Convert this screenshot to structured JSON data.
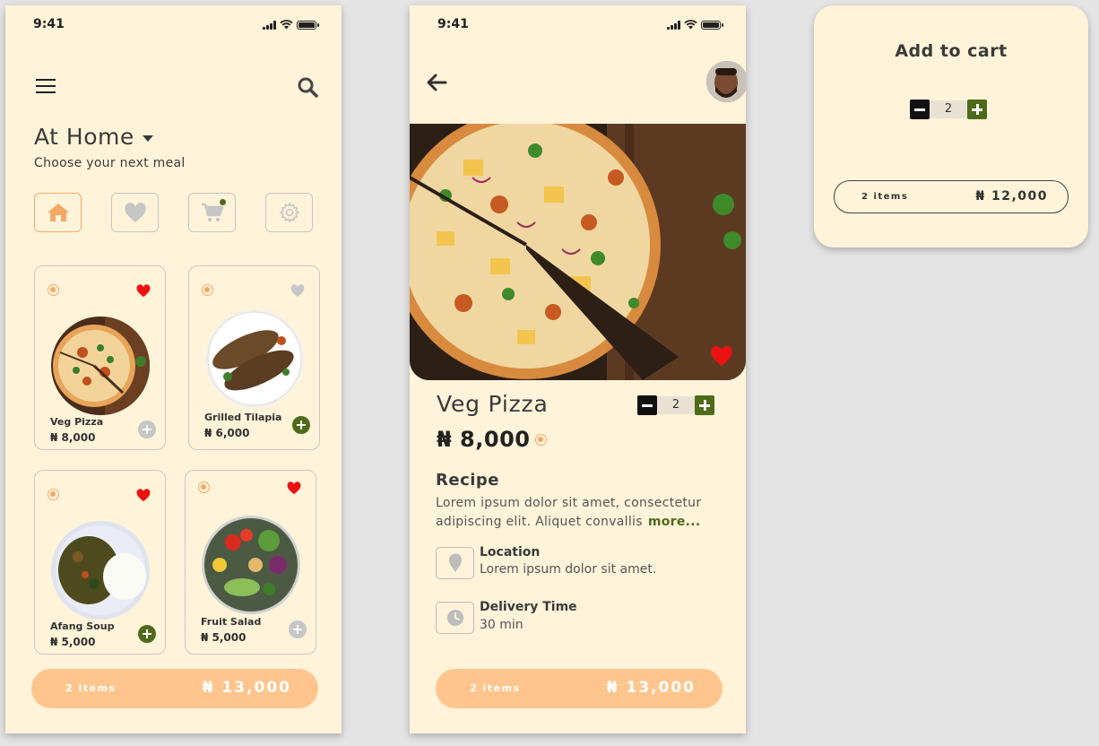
{
  "status_bar": {
    "time": "9:41"
  },
  "home": {
    "location_title": "At Home",
    "subtitle": "Choose your next meal",
    "nav": [
      {
        "name": "home",
        "active": true
      },
      {
        "name": "favorites",
        "active": false
      },
      {
        "name": "cart",
        "active": false,
        "badge": true
      },
      {
        "name": "settings",
        "active": false
      }
    ],
    "meals": [
      {
        "name": "Veg Pizza",
        "price": "₦ 8,000",
        "favorite": true,
        "added": false
      },
      {
        "name": "Grilled Tilapia",
        "price": "₦ 6,000",
        "favorite": false,
        "added": true
      },
      {
        "name": "Afang Soup",
        "price": "₦ 5,000",
        "favorite": true,
        "added": true
      },
      {
        "name": "Fruit Salad",
        "price": "₦ 5,000",
        "favorite": true,
        "added": false
      }
    ],
    "bottom_bar": {
      "items": "2 items",
      "total": "₦ 13,000"
    }
  },
  "detail": {
    "title": "Veg Pizza",
    "quantity": "2",
    "price": "₦ 8,000",
    "recipe_heading": "Recipe",
    "recipe_text": "Lorem ipsum dolor sit amet, consectetur adipiscing elit. Aliquet convallis",
    "more_label": "more...",
    "location_heading": "Location",
    "location_text": "Lorem ipsum dolor sit amet.",
    "delivery_heading": "Delivery Time",
    "delivery_text": "30 min",
    "bottom_bar": {
      "items": "2 items",
      "total": "₦ 13,000"
    }
  },
  "cart": {
    "title": "Add to cart",
    "quantity": "2",
    "items": "2 items",
    "total": "₦ 12,000"
  },
  "colors": {
    "background": "#fff3d9",
    "accent_orange": "#ffc58d",
    "accent_green": "#4e6b1a",
    "heart_red": "#ee1111",
    "radio_orange": "#f4a866"
  },
  "icons": [
    "menu-icon",
    "search-icon",
    "home-icon",
    "heart-icon",
    "cart-icon",
    "gear-icon",
    "back-arrow-icon",
    "location-pin-icon",
    "clock-icon",
    "plus-icon",
    "minus-icon"
  ]
}
